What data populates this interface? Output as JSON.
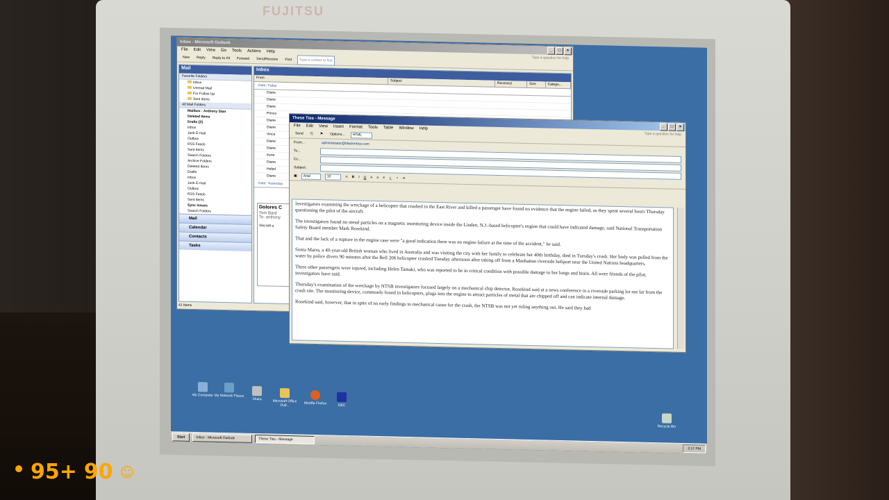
{
  "outlook": {
    "title": "Inbox - Microsoft Outlook",
    "menu": [
      "File",
      "Edit",
      "View",
      "Go",
      "Tools",
      "Actions",
      "Help"
    ],
    "toolbar": [
      "New",
      "Reply",
      "Reply to All",
      "Forward",
      "Send/Receive",
      "Find",
      "Type a contact to find"
    ],
    "help_placeholder": "Type a question for help",
    "nav_header": "Mail",
    "favorites_label": "Favorite Folders",
    "favorites": [
      "Inbox",
      "Unread Mail",
      "For Follow Up",
      "Sent Items"
    ],
    "all_mail_label": "All Mail Folders",
    "mailbox_label": "Mailbox - Anthony Stan",
    "folders": [
      "Deleted Items",
      "Drafts [2]",
      "Inbox",
      "Junk E-mail",
      "Outbox",
      "RSS Feeds",
      "Sent Items",
      "Search Folders"
    ],
    "archive_label": "Archive Folders",
    "archive_folders": [
      "Deleted Items",
      "Drafts",
      "Inbox",
      "Junk E-mail",
      "Outbox",
      "RSS Feeds",
      "Sent Items",
      "Sync Issues",
      "Search Folders"
    ],
    "nav_buttons": [
      "Mail",
      "Calendar",
      "Contacts",
      "Tasks"
    ],
    "inbox_header": "Inbox",
    "columns": [
      "From",
      "Subject",
      "Received",
      "Size",
      "Catego..."
    ],
    "group_today": "Date: Today",
    "group_yesterday": "Date: Yesterday",
    "senders": [
      "Diane",
      "Diane",
      "Diane",
      "Prince",
      "Diane",
      "Diane",
      "Vince",
      "Diane",
      "Diane",
      "Irene",
      "Diane",
      "Helpd",
      "Diane"
    ],
    "reading_title": "Dolores C",
    "reading_from": "Tom Bard",
    "reading_to": "To: anthony",
    "reading_body": "She left a",
    "status": "41 Items"
  },
  "message": {
    "title": "These Ties - Message",
    "menu": [
      "File",
      "Edit",
      "View",
      "Insert",
      "Format",
      "Tools",
      "Table",
      "Window",
      "Help"
    ],
    "toolbar": [
      "Send",
      "Options...",
      "HTML"
    ],
    "help_placeholder": "Type a question for help",
    "from_label": "From...",
    "from_value": "administrator@blackmesa.com",
    "to_label": "To...",
    "cc_label": "Cc...",
    "subject_label": "Subject:",
    "font": "Arial",
    "size": "10",
    "paragraphs": [
      "Investigators examining the wreckage of a helicopter that crashed in the East River and killed a passenger have found no evidence that the engine failed, as they spent several hours Thursday questioning the pilot of the aircraft.",
      "The investigators found no metal particles on a magnetic monitoring device inside the Linden, N.J.-based helicopter's engine that could have indicated damage, said National Transportation Safety Board member Mark Rosekind.",
      "That and the lack of a rupture in the engine case were \"a good indication there was no engine failure at the time of the accident,\" he said.",
      "Sonia Marra, a 40-year-old British woman who lived in Australia and was visiting the city with her family to celebrate her 40th birthday, died in Tuesday's crash. Her body was pulled from the water by police divers 90 minutes after the Bell 206 helicopter crashed Tuesday afternoon after taking off from a Manhattan riverside heliport near the United Nations headquarters.",
      "Three other passengers were injured, including Helen Tamaki, who was reported to be in critical condition with possible damage to her lungs and brain. All were friends of the pilot, investigators have said.",
      "Thursday's examination of the wreckage by NTSB investigators focused largely on a mechanical chip detector, Rosekind said at a news conference in a riverside parking lot not far from the crash site. The monitoring device, commonly found in helicopters, plugs into the engine to attract particles of metal that are chipped off and can indicate internal damage.",
      "Rosekind said, however, that in spite of no early findings to mechanical cause for the crash, the NTSB was not yet ruling anything out. He said they had"
    ]
  },
  "desktop": {
    "icons": [
      "My Computer",
      "My Network Places",
      "Shara",
      "Microsoft Office Outl...",
      "Mozilla Firefox",
      "DEC"
    ],
    "recycle": "Recycle Bin"
  },
  "taskbar": {
    "start": "Start",
    "tasks": [
      "Inbox - Microsoft Outlook",
      "These Ties - Message"
    ],
    "clock": "2:17 PM"
  },
  "monitor": {
    "brand": "FUJITSU"
  },
  "hud": {
    "health": "95+",
    "armor": "90"
  },
  "colors": {
    "hud": "#ffa500",
    "desktop": "#3a6ea5",
    "titlebar": "#0a246a"
  }
}
